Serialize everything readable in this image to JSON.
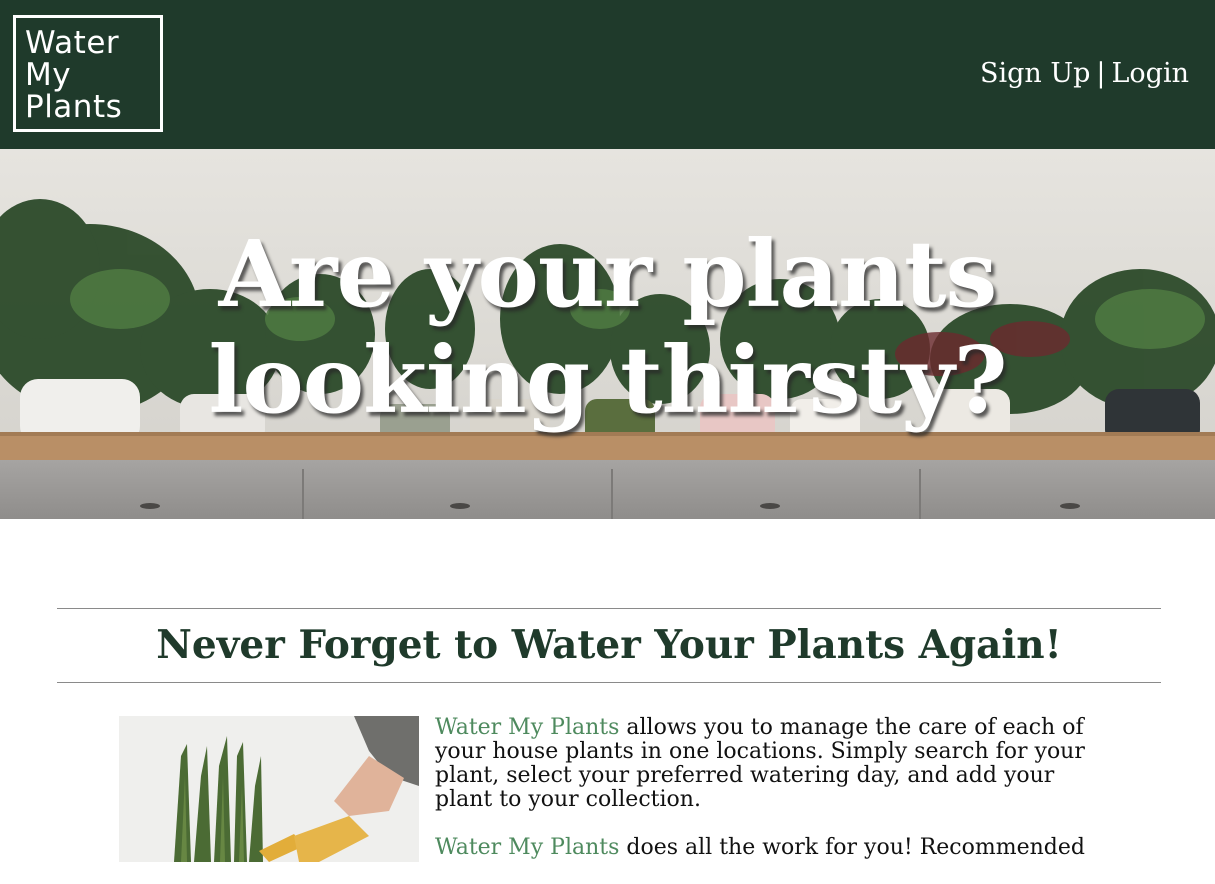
{
  "header": {
    "logo_lines": [
      "Water",
      "My",
      "Plants"
    ],
    "signup_label": "Sign Up",
    "separator": "|",
    "login_label": "Login"
  },
  "hero": {
    "title_line1": "Are your plants",
    "title_line2": "looking thirsty?"
  },
  "section": {
    "title": "Never Forget to Water Your Plants Again!",
    "paragraphs": [
      {
        "brand": "Water My Plants",
        "text": " allows you to manage the care of each of your house plants in one locations. Simply search for your plant, select your preferred watering day, and add your plant to your collection."
      },
      {
        "brand": "Water My Plants",
        "text": " does all the work for you! Recommended"
      }
    ]
  },
  "colors": {
    "header_bg": "#1f3a2b",
    "title_green": "#1f3a2b",
    "brand_link": "#4e8a5e"
  },
  "icons": {
    "hero_image": "potted-plants-on-cabinet-photo",
    "section_image": "snake-plant-watering-photo"
  }
}
